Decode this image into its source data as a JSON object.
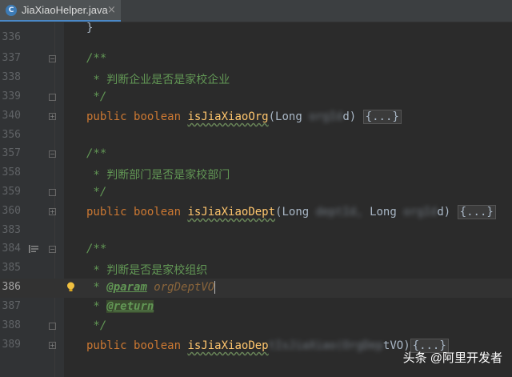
{
  "tab": {
    "filename": "JiaXiaoHelper.java",
    "icon_letter": "C",
    "icon": "class-icon",
    "close_glyph": "×"
  },
  "gutter": {
    "lines": [
      "336",
      "337",
      "338",
      "339",
      "340",
      "356",
      "357",
      "358",
      "359",
      "360",
      "383",
      "384",
      "385",
      "386",
      "387",
      "388",
      "389"
    ]
  },
  "code": {
    "l336": "}",
    "l337": "/**",
    "l338_star": " * ",
    "l338_text": "判断企业是否是家校企业",
    "l339": " */",
    "l340_public": "public",
    "l340_boolean": "boolean",
    "l340_name": "isJiaXiaoOrg",
    "l340_params_a": "(Long ",
    "l340_params_blur": "orgId",
    "l340_params_b": "d) ",
    "l340_fold": "{...}",
    "l357": "/**",
    "l358_star": " * ",
    "l358_text": "判断部门是否是家校部门",
    "l359": " */",
    "l360_public": "public",
    "l360_boolean": "boolean",
    "l360_name": "isJiaXiaoDept",
    "l360_params_a": "(Long ",
    "l360_params_blur1": "deptId,",
    "l360_params_mid": " Long ",
    "l360_params_blur2": "orgId",
    "l360_params_b": "d) ",
    "l360_fold": "{...}",
    "l384": "/**",
    "l385_star": " * ",
    "l385_text": "判断是否是家校组织",
    "l386_star": " * ",
    "l386_tag": "@param",
    "l386_param": " orgDeptVO",
    "l387_star": " * ",
    "l387_tag": "@return",
    "l388": " */",
    "l389_public": "public",
    "l389_boolean": "boolean",
    "l389_name": "isJiaXiaoDep",
    "l389_blur": "tIsJiaXiao(OrgDep",
    "l389_b": "tVO)",
    "l389_fold": "{...}"
  },
  "watermark": "头条 @阿里开发者",
  "colors": {
    "background": "#2b2b2b",
    "keyword": "#cc7832",
    "method": "#ffc66d",
    "comment": "#629755",
    "text": "#a9b7c6"
  }
}
